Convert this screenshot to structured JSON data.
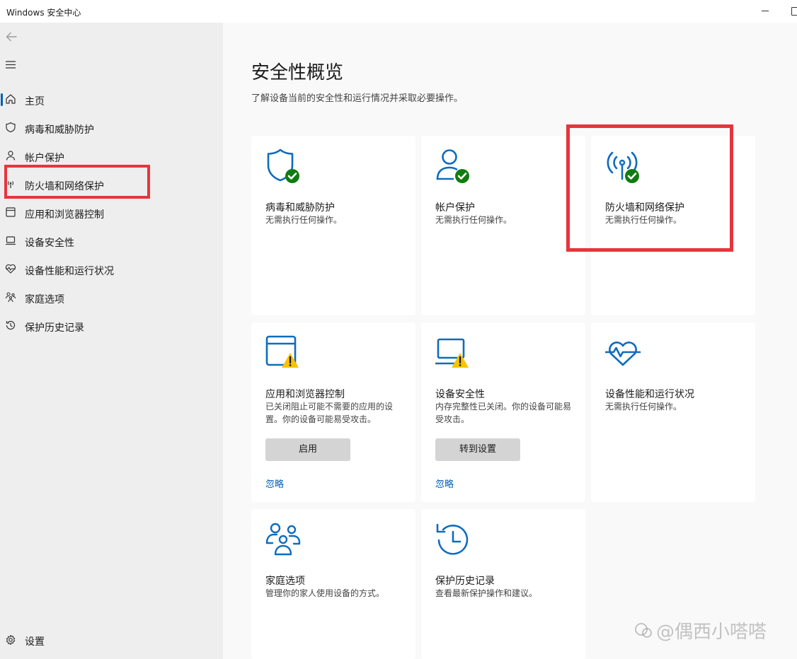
{
  "window": {
    "title": "Windows 安全中心"
  },
  "sidebar": {
    "items": [
      {
        "label": "主页",
        "icon": "home-icon"
      },
      {
        "label": "病毒和威胁防护",
        "icon": "shield-icon"
      },
      {
        "label": "帐户保护",
        "icon": "person-icon"
      },
      {
        "label": "防火墙和网络保护",
        "icon": "antenna-icon"
      },
      {
        "label": "应用和浏览器控制",
        "icon": "app-browser-icon"
      },
      {
        "label": "设备安全性",
        "icon": "laptop-icon"
      },
      {
        "label": "设备性能和运行状况",
        "icon": "heart-pulse-icon"
      },
      {
        "label": "家庭选项",
        "icon": "family-icon"
      },
      {
        "label": "保护历史记录",
        "icon": "history-icon"
      }
    ],
    "settings_label": "设置"
  },
  "main": {
    "title": "安全性概览",
    "subtitle": "了解设备当前的安全性和运行情况并采取必要操作。",
    "cards": [
      {
        "title": "病毒和威胁防护",
        "desc": "无需执行任何操作。",
        "icon": "shield-check-icon",
        "status": "ok"
      },
      {
        "title": "帐户保护",
        "desc": "无需执行任何操作。",
        "icon": "person-check-icon",
        "status": "ok"
      },
      {
        "title": "防火墙和网络保护",
        "desc": "无需执行任何操作。",
        "icon": "antenna-check-icon",
        "status": "ok"
      },
      {
        "title": "应用和浏览器控制",
        "desc": "已关闭阻止可能不需要的应用的设置。你的设备可能易受攻击。",
        "icon": "app-browser-warning-icon",
        "status": "warning",
        "button": "启用",
        "link": "忽略"
      },
      {
        "title": "设备安全性",
        "desc": "内存完整性已关闭。你的设备可能易受攻击。",
        "icon": "laptop-warning-icon",
        "status": "warning",
        "button": "转到设置",
        "link": "忽略"
      },
      {
        "title": "设备性能和运行状况",
        "desc": "无需执行任何操作。",
        "icon": "heart-pulse-icon",
        "status": "ok"
      },
      {
        "title": "家庭选项",
        "desc": "管理你的家人使用设备的方式。",
        "icon": "family-icon"
      },
      {
        "title": "保护历史记录",
        "desc": "查看最新保护操作和建议。",
        "icon": "history-icon"
      }
    ]
  },
  "watermark": "@偶西小嗒嗒",
  "colors": {
    "accent": "#005fb8",
    "icon_blue": "#0f6cbd",
    "ok_green": "#107c10",
    "warning_yellow": "#f7c300",
    "annotation_red": "#e8343c"
  }
}
